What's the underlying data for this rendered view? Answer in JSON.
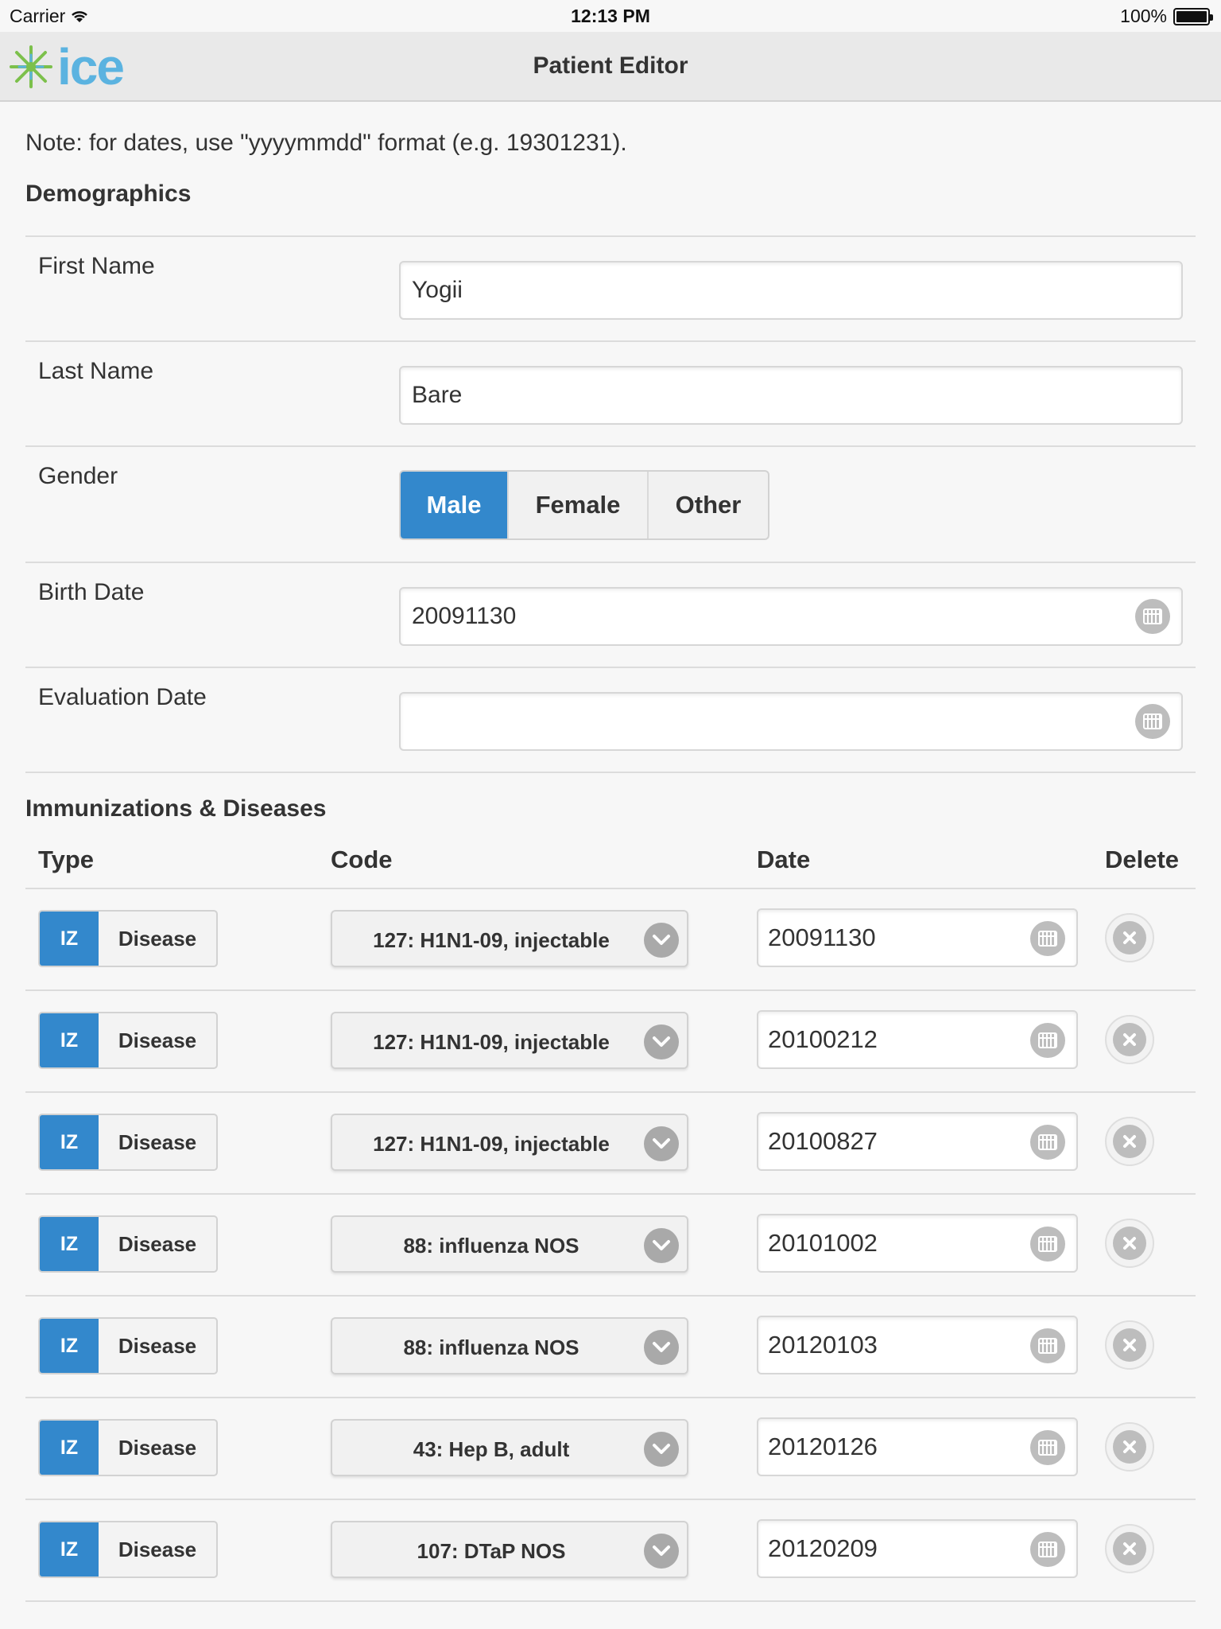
{
  "status_bar": {
    "carrier": "Carrier",
    "time": "12:13 PM",
    "battery": "100%"
  },
  "header": {
    "logo_text": "ice",
    "title": "Patient Editor"
  },
  "note": "Note: for dates, use \"yyyymmdd\" format (e.g. 19301231).",
  "demographics": {
    "section_title": "Demographics",
    "first_name": {
      "label": "First Name",
      "value": "Yogii"
    },
    "last_name": {
      "label": "Last Name",
      "value": "Bare"
    },
    "gender": {
      "label": "Gender",
      "options": [
        "Male",
        "Female",
        "Other"
      ],
      "selected": "Male"
    },
    "birth_date": {
      "label": "Birth Date",
      "value": "20091130"
    },
    "evaluation_date": {
      "label": "Evaluation Date",
      "value": ""
    }
  },
  "immunizations": {
    "section_title": "Immunizations & Diseases",
    "columns": [
      "Type",
      "Code",
      "Date",
      "Delete"
    ],
    "rows": [
      {
        "type_selected": "IZ",
        "type_other": "Disease",
        "code": "127: H1N1-09, injectable",
        "date": "20091130"
      },
      {
        "type_selected": "IZ",
        "type_other": "Disease",
        "code": "127: H1N1-09, injectable",
        "date": "20100212"
      },
      {
        "type_selected": "IZ",
        "type_other": "Disease",
        "code": "127: H1N1-09, injectable",
        "date": "20100827"
      },
      {
        "type_selected": "IZ",
        "type_other": "Disease",
        "code": "88: influenza NOS",
        "date": "20101002"
      },
      {
        "type_selected": "IZ",
        "type_other": "Disease",
        "code": "88: influenza NOS",
        "date": "20120103"
      },
      {
        "type_selected": "IZ",
        "type_other": "Disease",
        "code": "43: Hep B, adult",
        "date": "20120126"
      },
      {
        "type_selected": "IZ",
        "type_other": "Disease",
        "code": "107: DTaP NOS",
        "date": "20120209"
      }
    ]
  },
  "colors": {
    "accent": "#3388cc",
    "logo": "#5bb3e0",
    "logo_star": "#7cc04b"
  }
}
